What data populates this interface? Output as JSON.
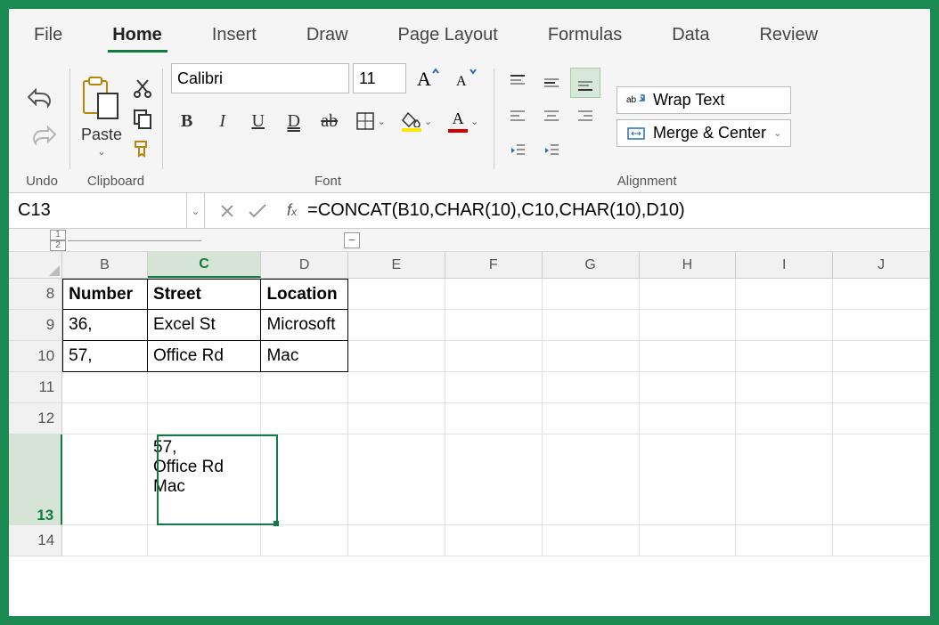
{
  "tabs": [
    "File",
    "Home",
    "Insert",
    "Draw",
    "Page Layout",
    "Formulas",
    "Data",
    "Review"
  ],
  "active_tab": 1,
  "ribbon": {
    "undo_label": "Undo",
    "clipboard_label": "Clipboard",
    "paste_label": "Paste",
    "font_label": "Font",
    "font_name": "Calibri",
    "font_size": "11",
    "alignment_label": "Alignment",
    "wrap_text": "Wrap Text",
    "merge_center": "Merge & Center",
    "fill_color": "#ffe600",
    "font_color": "#d40000"
  },
  "namebox": "C13",
  "formula": "=CONCAT(B10,CHAR(10),C10,CHAR(10),D10)",
  "outline": {
    "levels": [
      "1",
      "2"
    ],
    "collapse": "−"
  },
  "columns": [
    "B",
    "C",
    "D",
    "E",
    "F",
    "G",
    "H",
    "I",
    "J"
  ],
  "rows": [
    "8",
    "9",
    "10",
    "11",
    "12",
    "13",
    "14"
  ],
  "selected_column": "C",
  "selected_row": "13",
  "table": {
    "headers": {
      "B": "Number",
      "C": "Street",
      "D": "Location"
    },
    "r9": {
      "B": "36,",
      "C": "Excel St",
      "D": "Microsoft"
    },
    "r10": {
      "B": "57,",
      "C": "Office Rd",
      "D": "Mac"
    }
  },
  "c13_content": "57,\nOffice Rd\nMac",
  "chart_data": {
    "type": "table",
    "title": "",
    "columns": [
      "Number",
      "Street",
      "Location"
    ],
    "rows": [
      [
        "36,",
        "Excel St",
        "Microsoft"
      ],
      [
        "57,",
        "Office Rd",
        "Mac"
      ]
    ]
  }
}
